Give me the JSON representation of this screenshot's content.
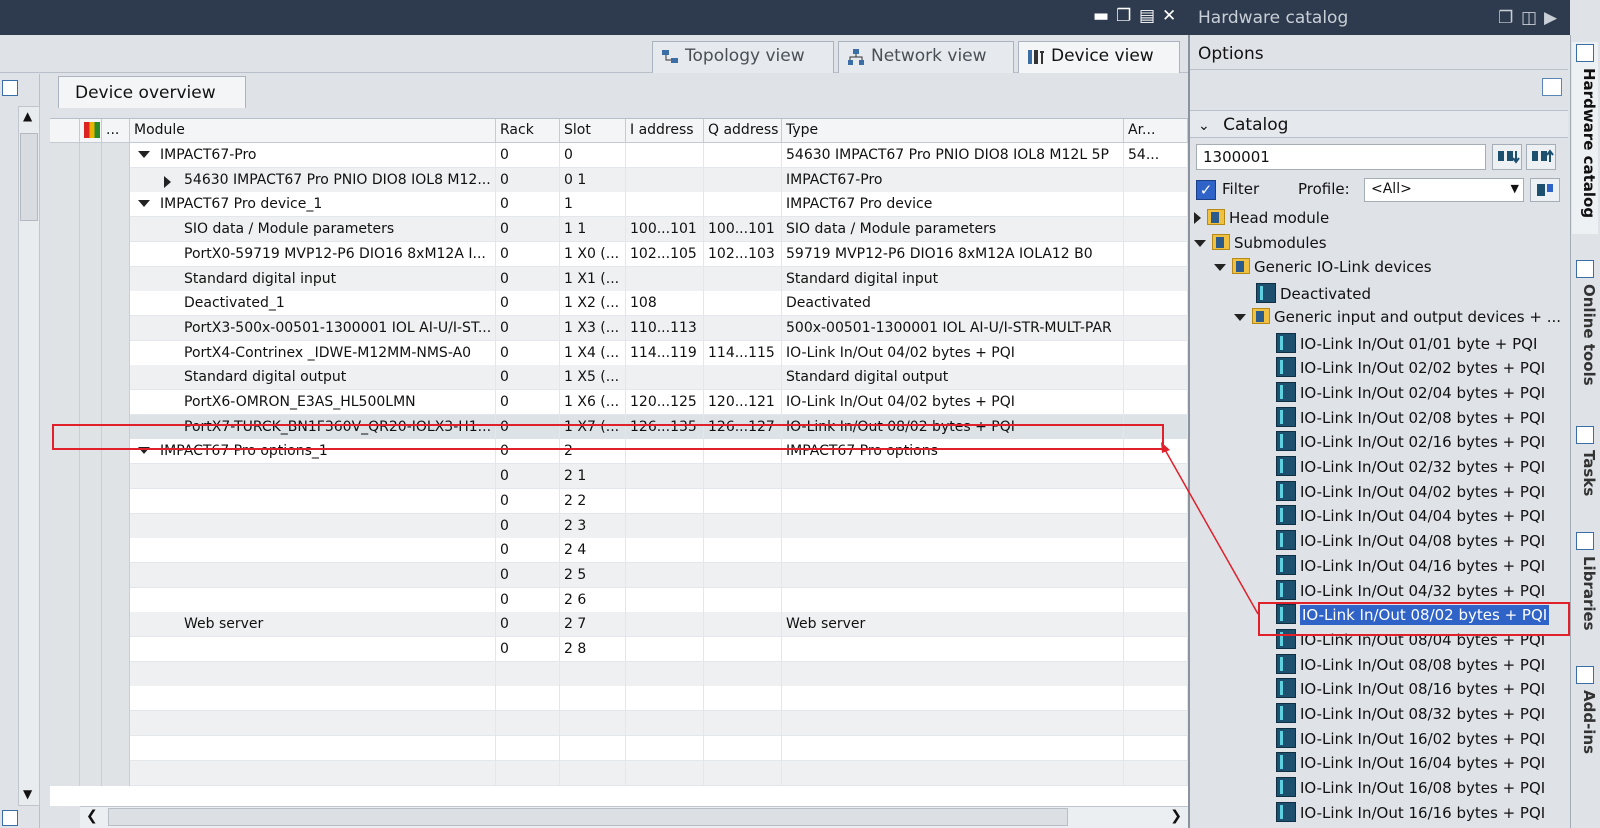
{
  "window": {
    "right_title": "Hardware catalog"
  },
  "view_tabs": {
    "topology": "Topology view",
    "network": "Network view",
    "device": "Device view"
  },
  "device_overview": {
    "tab_label": "Device overview",
    "columns": [
      "",
      "",
      "...",
      "Module",
      "Rack",
      "Slot",
      "I address",
      "Q address",
      "Type",
      "Ar..."
    ],
    "rows": [
      {
        "indent": 1,
        "expander": "down",
        "module": "IMPACT67-Pro",
        "rack": "0",
        "slot": "0",
        "iaddr": "",
        "qaddr": "",
        "type": "54630 IMPACT67 Pro PNIO DIO8 IOL8 M12L 5P",
        "ar": "54..."
      },
      {
        "indent": 2,
        "expander": "right",
        "module": "54630 IMPACT67 Pro PNIO DIO8 IOL8 M12...",
        "rack": "0",
        "slot": "0 1",
        "iaddr": "",
        "qaddr": "",
        "type": "IMPACT67-Pro",
        "ar": ""
      },
      {
        "indent": 1,
        "expander": "down",
        "module": "IMPACT67 Pro device_1",
        "rack": "0",
        "slot": "1",
        "iaddr": "",
        "qaddr": "",
        "type": "IMPACT67 Pro device",
        "ar": ""
      },
      {
        "indent": 2,
        "expander": "",
        "module": "SIO data / Module parameters",
        "rack": "0",
        "slot": "1 1",
        "iaddr": "100...101",
        "qaddr": "100...101",
        "type": "SIO data / Module parameters",
        "ar": ""
      },
      {
        "indent": 2,
        "expander": "",
        "module": "PortX0-59719 MVP12-P6 DIO16 8xM12A I...",
        "rack": "0",
        "slot": "1 X0 (...",
        "iaddr": "102...105",
        "qaddr": "102...103",
        "type": "59719 MVP12-P6 DIO16 8xM12A IOLA12 B0",
        "ar": ""
      },
      {
        "indent": 2,
        "expander": "",
        "module": "Standard digital input",
        "rack": "0",
        "slot": "1 X1 (...",
        "iaddr": "",
        "qaddr": "",
        "type": "Standard digital input",
        "ar": ""
      },
      {
        "indent": 2,
        "expander": "",
        "module": "Deactivated_1",
        "rack": "0",
        "slot": "1 X2 (...",
        "iaddr": "108",
        "qaddr": "",
        "type": "Deactivated",
        "ar": ""
      },
      {
        "indent": 2,
        "expander": "",
        "module": "PortX3-500x-00501-1300001 IOL AI-U/I-ST...",
        "rack": "0",
        "slot": "1 X3 (...",
        "iaddr": "110...113",
        "qaddr": "",
        "type": "500x-00501-1300001 IOL AI-U/I-STR-MULT-PAR",
        "ar": ""
      },
      {
        "indent": 2,
        "expander": "",
        "module": "PortX4-Contrinex _IDWE-M12MM-NMS-A0",
        "rack": "0",
        "slot": "1 X4 (...",
        "iaddr": "114...119",
        "qaddr": "114...115",
        "type": "IO-Link In/Out 04/02 bytes + PQI",
        "ar": ""
      },
      {
        "indent": 2,
        "expander": "",
        "module": "Standard digital output",
        "rack": "0",
        "slot": "1 X5 (...",
        "iaddr": "",
        "qaddr": "",
        "type": "Standard digital output",
        "ar": ""
      },
      {
        "indent": 2,
        "expander": "",
        "module": "PortX6-OMRON_E3AS_HL500LMN",
        "rack": "0",
        "slot": "1 X6 (...",
        "iaddr": "120...125",
        "qaddr": "120...121",
        "type": "IO-Link In/Out 04/02 bytes + PQI",
        "ar": ""
      },
      {
        "indent": 2,
        "expander": "",
        "module": "PortX7-TURCK_BN1F360V_QR20-IOLX3-H1...",
        "rack": "0",
        "slot": "1 X7 (...",
        "iaddr": "126...135",
        "qaddr": "126...127",
        "type": "IO-Link In/Out 08/02 bytes + PQI",
        "ar": ""
      },
      {
        "indent": 1,
        "expander": "down",
        "module": "IMPACT67 Pro options_1",
        "rack": "0",
        "slot": "2",
        "iaddr": "",
        "qaddr": "",
        "type": "IMPACT67 Pro options",
        "ar": ""
      },
      {
        "indent": 2,
        "expander": "",
        "module": "",
        "rack": "0",
        "slot": "2 1",
        "iaddr": "",
        "qaddr": "",
        "type": "",
        "ar": ""
      },
      {
        "indent": 2,
        "expander": "",
        "module": "",
        "rack": "0",
        "slot": "2 2",
        "iaddr": "",
        "qaddr": "",
        "type": "",
        "ar": ""
      },
      {
        "indent": 2,
        "expander": "",
        "module": "",
        "rack": "0",
        "slot": "2 3",
        "iaddr": "",
        "qaddr": "",
        "type": "",
        "ar": ""
      },
      {
        "indent": 2,
        "expander": "",
        "module": "",
        "rack": "0",
        "slot": "2 4",
        "iaddr": "",
        "qaddr": "",
        "type": "",
        "ar": ""
      },
      {
        "indent": 2,
        "expander": "",
        "module": "",
        "rack": "0",
        "slot": "2 5",
        "iaddr": "",
        "qaddr": "",
        "type": "",
        "ar": ""
      },
      {
        "indent": 2,
        "expander": "",
        "module": "",
        "rack": "0",
        "slot": "2 6",
        "iaddr": "",
        "qaddr": "",
        "type": "",
        "ar": ""
      },
      {
        "indent": 2,
        "expander": "",
        "module": "Web server",
        "rack": "0",
        "slot": "2 7",
        "iaddr": "",
        "qaddr": "",
        "type": "Web server",
        "ar": ""
      },
      {
        "indent": 2,
        "expander": "",
        "module": "",
        "rack": "0",
        "slot": "2 8",
        "iaddr": "",
        "qaddr": "",
        "type": "",
        "ar": ""
      }
    ],
    "selected_row": 11
  },
  "catalog": {
    "options_label": "Options",
    "catalog_label": "Catalog",
    "search_value": "1300001",
    "filter_label": "Filter",
    "filter_checked": true,
    "profile_label": "Profile:",
    "profile_value": "<All>",
    "tree": [
      {
        "level": 0,
        "kind": "folder",
        "exp": "right",
        "label": "Head module"
      },
      {
        "level": 0,
        "kind": "folder",
        "exp": "down",
        "label": "Submodules"
      },
      {
        "level": 1,
        "kind": "folder",
        "exp": "down",
        "label": "Generic IO-Link devices"
      },
      {
        "level": 2,
        "kind": "module",
        "exp": "",
        "label": "Deactivated"
      },
      {
        "level": 2,
        "kind": "folder",
        "exp": "down",
        "label": "Generic input and output devices + ..."
      },
      {
        "level": 3,
        "kind": "module",
        "exp": "",
        "label": "IO-Link In/Out 01/01 byte + PQI"
      },
      {
        "level": 3,
        "kind": "module",
        "exp": "",
        "label": "IO-Link In/Out 02/02 bytes + PQI"
      },
      {
        "level": 3,
        "kind": "module",
        "exp": "",
        "label": "IO-Link In/Out 02/04 bytes + PQI"
      },
      {
        "level": 3,
        "kind": "module",
        "exp": "",
        "label": "IO-Link In/Out 02/08 bytes + PQI"
      },
      {
        "level": 3,
        "kind": "module",
        "exp": "",
        "label": "IO-Link In/Out 02/16 bytes + PQI"
      },
      {
        "level": 3,
        "kind": "module",
        "exp": "",
        "label": "IO-Link In/Out 02/32 bytes + PQI"
      },
      {
        "level": 3,
        "kind": "module",
        "exp": "",
        "label": "IO-Link In/Out 04/02 bytes + PQI"
      },
      {
        "level": 3,
        "kind": "module",
        "exp": "",
        "label": "IO-Link In/Out 04/04 bytes + PQI"
      },
      {
        "level": 3,
        "kind": "module",
        "exp": "",
        "label": "IO-Link In/Out 04/08 bytes + PQI"
      },
      {
        "level": 3,
        "kind": "module",
        "exp": "",
        "label": "IO-Link In/Out 04/16 bytes + PQI"
      },
      {
        "level": 3,
        "kind": "module",
        "exp": "",
        "label": "IO-Link In/Out 04/32 bytes + PQI"
      },
      {
        "level": 3,
        "kind": "module",
        "exp": "",
        "label": "IO-Link In/Out 08/02 bytes + PQI",
        "selected": true
      },
      {
        "level": 3,
        "kind": "module",
        "exp": "",
        "label": "IO-Link In/Out 08/04 bytes + PQI"
      },
      {
        "level": 3,
        "kind": "module",
        "exp": "",
        "label": "IO-Link In/Out 08/08 bytes + PQI"
      },
      {
        "level": 3,
        "kind": "module",
        "exp": "",
        "label": "IO-Link In/Out 08/16 bytes + PQI"
      },
      {
        "level": 3,
        "kind": "module",
        "exp": "",
        "label": "IO-Link In/Out 08/32 bytes + PQI"
      },
      {
        "level": 3,
        "kind": "module",
        "exp": "",
        "label": "IO-Link In/Out 16/02 bytes + PQI"
      },
      {
        "level": 3,
        "kind": "module",
        "exp": "",
        "label": "IO-Link In/Out 16/04 bytes + PQI"
      },
      {
        "level": 3,
        "kind": "module",
        "exp": "",
        "label": "IO-Link In/Out 16/08 bytes + PQI"
      },
      {
        "level": 3,
        "kind": "module",
        "exp": "",
        "label": "IO-Link In/Out 16/16 bytes + PQI"
      }
    ]
  },
  "side_tabs": [
    "Hardware catalog",
    "Online tools",
    "Tasks",
    "Libraries",
    "Add-ins"
  ],
  "colors": {
    "title_bar": "#2e3a4d",
    "highlight": "#2f63c8",
    "annotation_red": "#e0202a"
  }
}
